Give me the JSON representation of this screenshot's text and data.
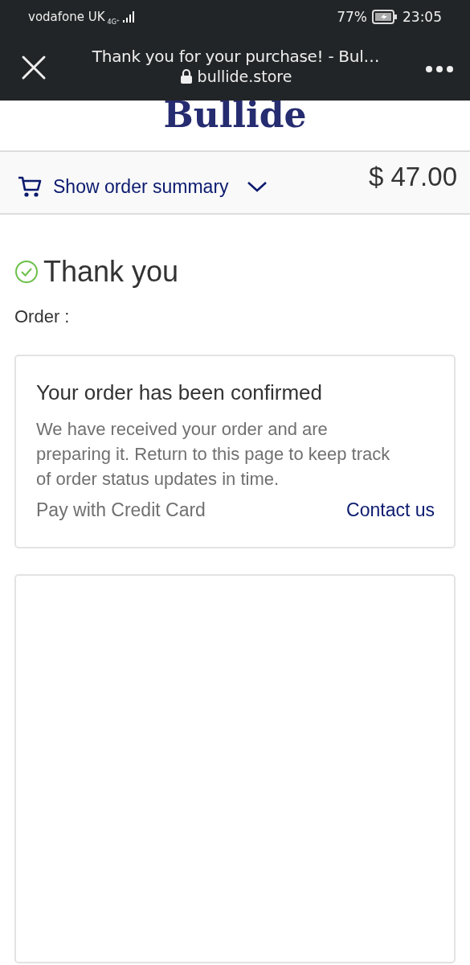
{
  "status_bar": {
    "carrier": "vodafone UK",
    "network": "4G⁺",
    "battery": "77%",
    "time": "23:05"
  },
  "browser": {
    "title": "Thank you for your purchase! - Bul…",
    "url": "bullide.store"
  },
  "store": {
    "logo": "Bullide"
  },
  "summary": {
    "label": "Show order summary",
    "total": "$ 47.00",
    "expanded": false
  },
  "heading": "Thank you",
  "order_label": "Order :",
  "confirmation": {
    "title": "Your order has been confirmed",
    "body": "We have received your order and are preparing it. Return to this page to keep track of order status updates in time.",
    "payment": "Pay with Credit Card",
    "contact": "Contact us"
  }
}
